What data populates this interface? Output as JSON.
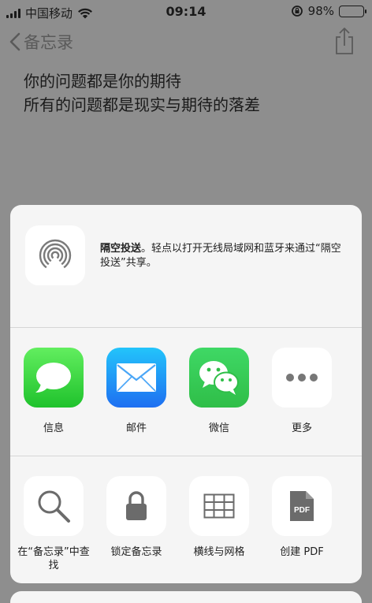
{
  "status": {
    "carrier": "中国移动",
    "time": "09:14",
    "battery": "98%",
    "battery_level": 0.98
  },
  "nav": {
    "back_label": "备忘录",
    "share_icon": "share-icon"
  },
  "note": {
    "lines": [
      "你的问题都是你的期待",
      "所有的问题都是现实与期待的落差"
    ]
  },
  "airdrop": {
    "title": "隔空投送",
    "description": "。轻点以打开无线局域网和蓝牙来通过“隔空投送”共享。",
    "icon": "airdrop-icon"
  },
  "apps": [
    {
      "label": "信息",
      "icon": "messages-icon",
      "color": "#3ad94a"
    },
    {
      "label": "邮件",
      "icon": "mail-icon",
      "color": "#1e8ff5"
    },
    {
      "label": "微信",
      "icon": "wechat-icon",
      "color": "#35cc55"
    },
    {
      "label": "更多",
      "icon": "more-icon"
    }
  ],
  "actions": [
    {
      "label": "在“备忘录”中查找",
      "icon": "search-icon"
    },
    {
      "label": "锁定备忘录",
      "icon": "lock-icon"
    },
    {
      "label": "横线与网格",
      "icon": "grid-icon"
    },
    {
      "label": "创建 PDF",
      "icon": "pdf-icon",
      "badge": "PDF"
    }
  ]
}
